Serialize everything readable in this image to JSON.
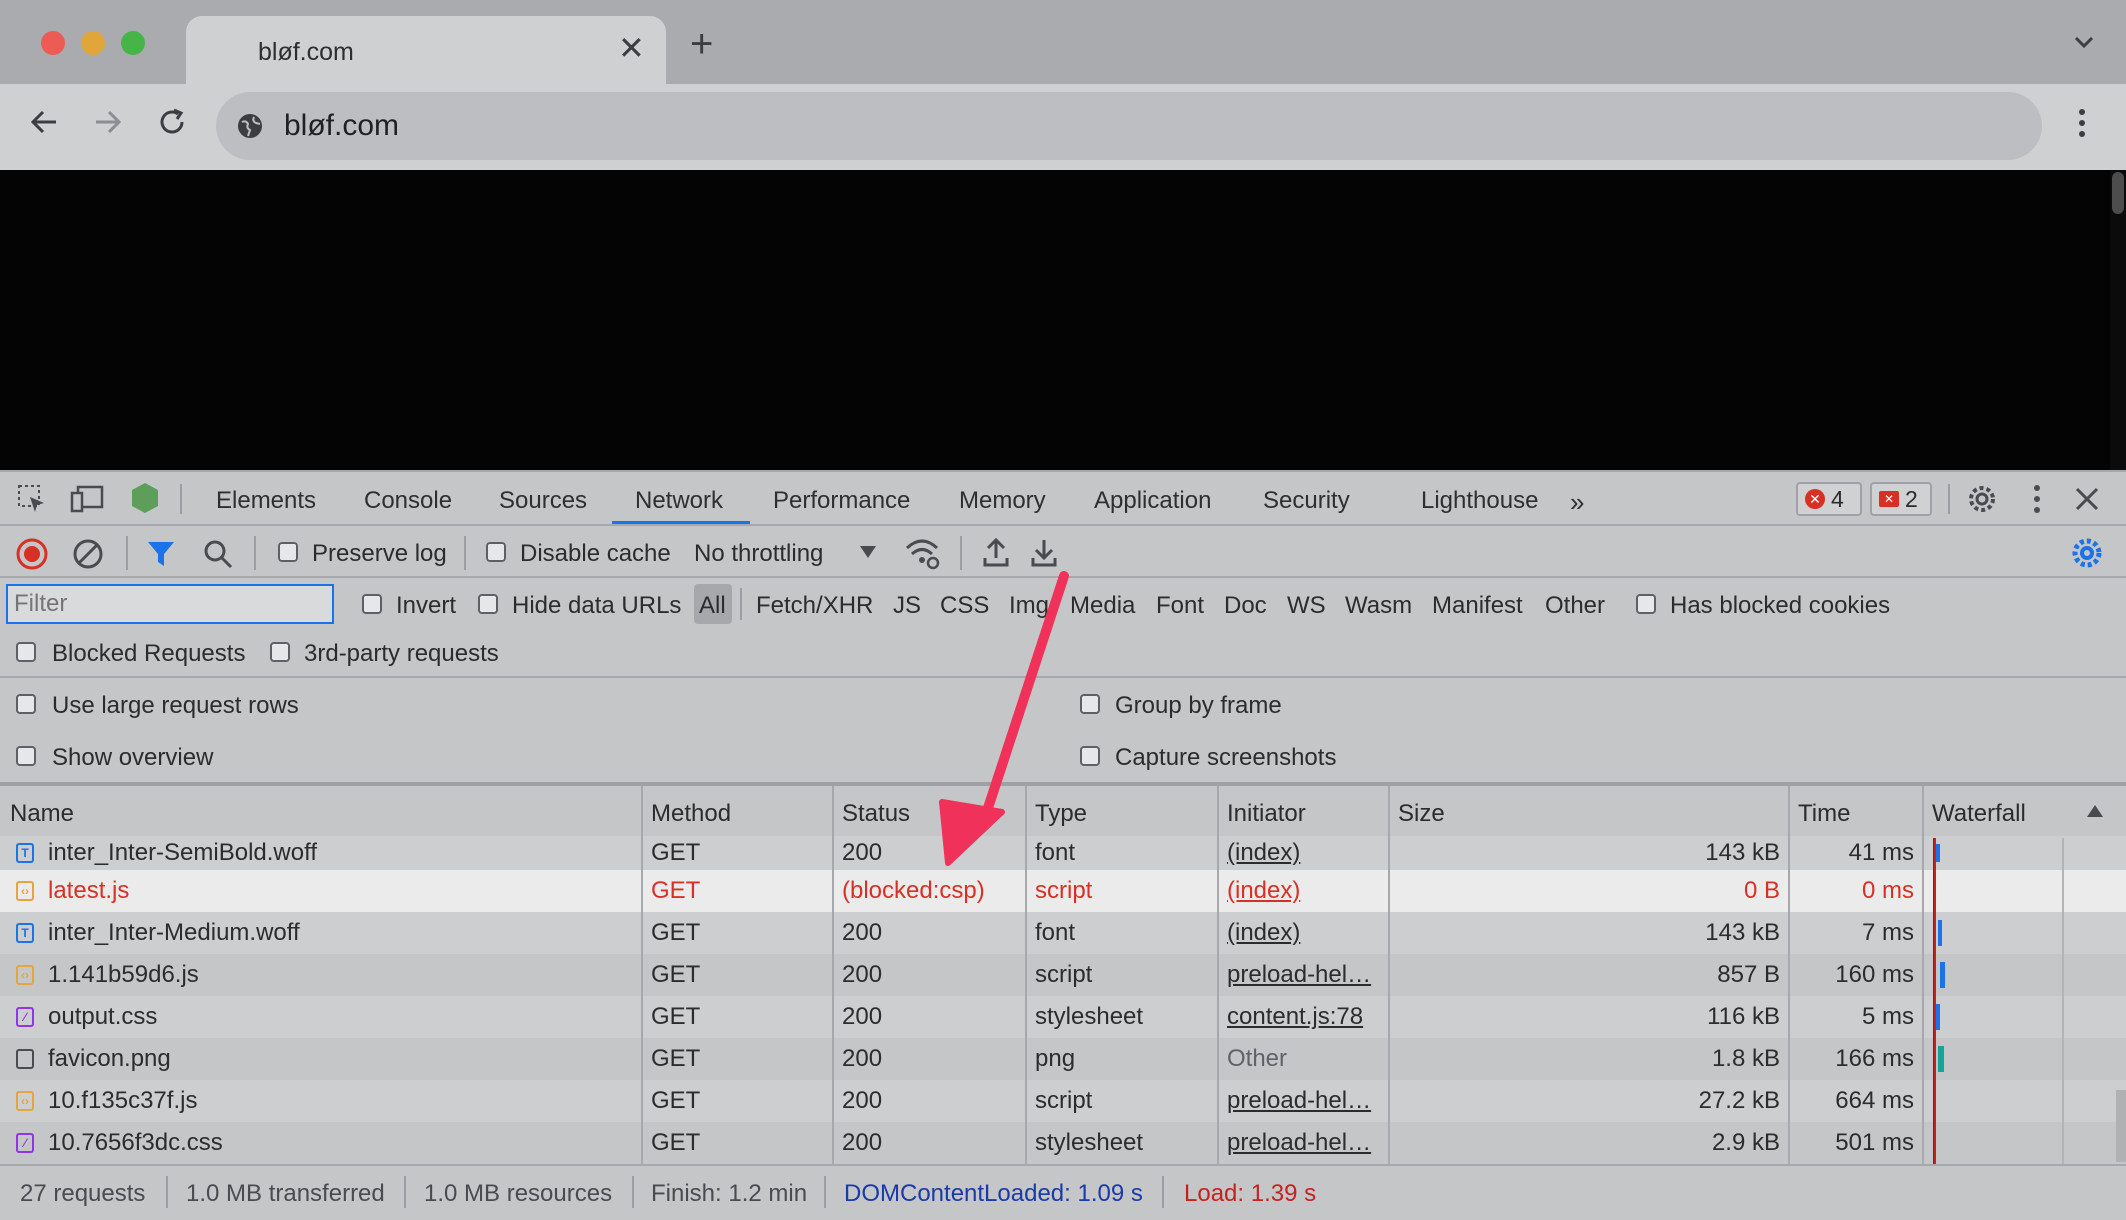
{
  "browser": {
    "tab_title": "bløf.com",
    "url": "bløf.com"
  },
  "devtools": {
    "tabs": [
      "Elements",
      "Console",
      "Sources",
      "Network",
      "Performance",
      "Memory",
      "Application",
      "Security",
      "Lighthouse"
    ],
    "active_tab": "Network",
    "error_count": "4",
    "issue_count": "2",
    "toolbar": {
      "preserve_log": "Preserve log",
      "disable_cache": "Disable cache",
      "throttling": "No throttling"
    },
    "filter": {
      "placeholder": "Filter",
      "invert": "Invert",
      "hide_data_urls": "Hide data URLs",
      "types": [
        "All",
        "Fetch/XHR",
        "JS",
        "CSS",
        "Img",
        "Media",
        "Font",
        "Doc",
        "WS",
        "Wasm",
        "Manifest",
        "Other"
      ],
      "has_blocked_cookies": "Has blocked cookies",
      "blocked_requests": "Blocked Requests",
      "third_party": "3rd-party requests"
    },
    "settings": {
      "large_rows": "Use large request rows",
      "group_by_frame": "Group by frame",
      "show_overview": "Show overview",
      "capture_screenshots": "Capture screenshots"
    },
    "columns": [
      "Name",
      "Method",
      "Status",
      "Type",
      "Initiator",
      "Size",
      "Time",
      "Waterfall"
    ],
    "rows": [
      {
        "name": "inter_Inter-SemiBold.woff",
        "method": "GET",
        "status": "200",
        "type": "font",
        "initiator": "(index)",
        "size": "143 kB",
        "time": "41 ms",
        "icon": "font-file-icon"
      },
      {
        "name": "latest.js",
        "method": "GET",
        "status": "(blocked:csp)",
        "type": "script",
        "initiator": "(index)",
        "size": "0 B",
        "time": "0 ms",
        "icon": "script-file-icon",
        "blocked": true
      },
      {
        "name": "inter_Inter-Medium.woff",
        "method": "GET",
        "status": "200",
        "type": "font",
        "initiator": "(index)",
        "size": "143 kB",
        "time": "7 ms",
        "icon": "font-file-icon"
      },
      {
        "name": "1.141b59d6.js",
        "method": "GET",
        "status": "200",
        "type": "script",
        "initiator": "preload-hel…",
        "size": "857 B",
        "time": "160 ms",
        "icon": "script-file-icon"
      },
      {
        "name": "output.css",
        "method": "GET",
        "status": "200",
        "type": "stylesheet",
        "initiator": "content.js:78",
        "size": "116 kB",
        "time": "5 ms",
        "icon": "stylesheet-file-icon"
      },
      {
        "name": "favicon.png",
        "method": "GET",
        "status": "200",
        "type": "png",
        "initiator": "Other",
        "size": "1.8 kB",
        "time": "166 ms",
        "icon": "image-file-icon"
      },
      {
        "name": "10.f135c37f.js",
        "method": "GET",
        "status": "200",
        "type": "script",
        "initiator": "preload-hel…",
        "size": "27.2 kB",
        "time": "664 ms",
        "icon": "script-file-icon"
      },
      {
        "name": "10.7656f3dc.css",
        "method": "GET",
        "status": "200",
        "type": "stylesheet",
        "initiator": "preload-hel…",
        "size": "2.9 kB",
        "time": "501 ms",
        "icon": "stylesheet-file-icon"
      }
    ],
    "summary": {
      "requests": "27 requests",
      "transferred": "1.0 MB transferred",
      "resources": "1.0 MB resources",
      "finish": "Finish: 1.2 min",
      "dom_content_loaded": "DOMContentLoaded: 1.09 s",
      "load": "Load: 1.39 s"
    }
  },
  "colors": {
    "accent": "#1a73e8",
    "error": "#d93025",
    "dcl": "#1a3aa8",
    "load": "#c5221f",
    "annotation_arrow": "#f0325a"
  }
}
